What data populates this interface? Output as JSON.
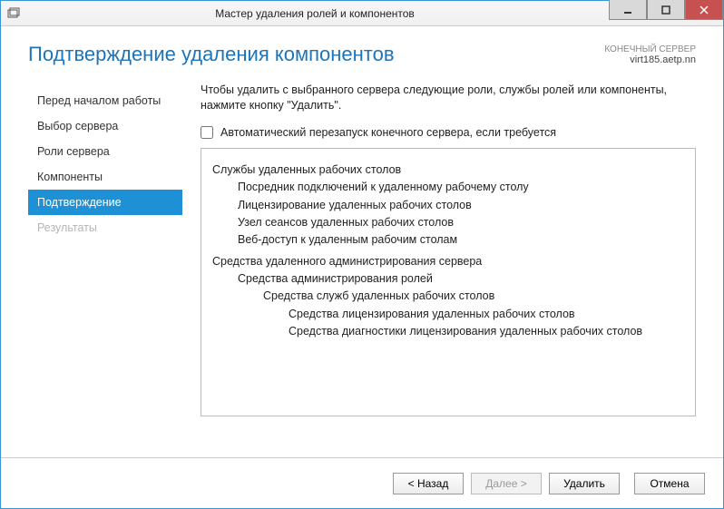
{
  "titlebar": {
    "title": "Мастер удаления ролей и компонентов"
  },
  "header": {
    "page_title": "Подтверждение удаления компонентов",
    "server_label": "КОНЕЧНЫЙ СЕРВЕР",
    "server_name": "virt185.aetp.nn"
  },
  "nav": {
    "items": [
      {
        "label": "Перед началом работы",
        "state": "normal"
      },
      {
        "label": "Выбор сервера",
        "state": "normal"
      },
      {
        "label": "Роли сервера",
        "state": "normal"
      },
      {
        "label": "Компоненты",
        "state": "normal"
      },
      {
        "label": "Подтверждение",
        "state": "selected"
      },
      {
        "label": "Результаты",
        "state": "disabled"
      }
    ]
  },
  "main": {
    "intro": "Чтобы удалить с выбранного сервера следующие роли, службы ролей или компоненты, нажмите кнопку \"Удалить\".",
    "checkbox_label": "Автоматический перезапуск конечного сервера, если требуется",
    "tree": [
      {
        "lvl": 0,
        "text": "Службы удаленных рабочих столов",
        "grp": true
      },
      {
        "lvl": 1,
        "text": "Посредник подключений к удаленному рабочему столу"
      },
      {
        "lvl": 1,
        "text": "Лицензирование удаленных рабочих столов"
      },
      {
        "lvl": 1,
        "text": "Узел сеансов удаленных рабочих столов"
      },
      {
        "lvl": 1,
        "text": "Веб-доступ к удаленным рабочим столам"
      },
      {
        "lvl": 0,
        "text": "Средства удаленного администрирования сервера",
        "grp": true
      },
      {
        "lvl": 1,
        "text": "Средства администрирования ролей"
      },
      {
        "lvl": 2,
        "text": "Средства служб удаленных рабочих столов"
      },
      {
        "lvl": 3,
        "text": "Средства лицензирования удаленных рабочих столов"
      },
      {
        "lvl": 3,
        "text": "Средства диагностики лицензирования удаленных рабочих столов"
      }
    ]
  },
  "footer": {
    "back": "< Назад",
    "next": "Далее >",
    "remove": "Удалить",
    "cancel": "Отмена"
  }
}
